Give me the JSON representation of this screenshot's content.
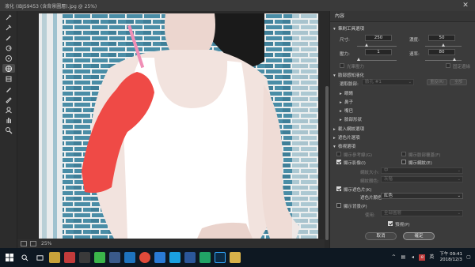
{
  "window": {
    "title": "液化 (IBJS9453 (含背景圖層).jpg @ 25%)"
  },
  "tools": [
    {
      "name": "forward-warp-tool-icon"
    },
    {
      "name": "reconstruct-tool-icon"
    },
    {
      "name": "smooth-tool-icon"
    },
    {
      "name": "twirl-tool-icon"
    },
    {
      "name": "pucker-tool-icon"
    },
    {
      "name": "bloat-tool-icon"
    },
    {
      "name": "push-left-tool-icon"
    },
    {
      "name": "freeze-mask-tool-icon"
    },
    {
      "name": "thaw-mask-tool-icon"
    },
    {
      "name": "face-tool-icon"
    },
    {
      "name": "hand-tool-icon"
    },
    {
      "name": "zoom-tool-icon"
    }
  ],
  "status": {
    "zoom": "25%"
  },
  "panel": {
    "title": "內容",
    "brush_tool_options": {
      "header": "筆刷工具選項",
      "size_label": "尺寸:",
      "size_value": "250",
      "density_label": "濃度:",
      "density_value": "50",
      "pressure_label": "壓力:",
      "pressure_value": "1",
      "rate_label": "速率:",
      "rate_value": "80",
      "stylus_pressure": "光筆壓力",
      "pin_edges": "固定邊緣"
    },
    "face_aware": {
      "header": "臉部感知液化",
      "select_face_label": "選取臉部:",
      "select_face_value": "臉孔 #1",
      "reset_label": "重設(R)",
      "all_label": "全部",
      "eyes": "眼睛",
      "nose": "鼻子",
      "mouth": "嘴巴",
      "face_shape": "臉部形狀"
    },
    "load_mesh": {
      "header": "載入網紋選項"
    },
    "mask_options": {
      "header": "遮色片選項"
    },
    "view_options": {
      "header": "檢視選項",
      "show_guides": "顯示參考線(G)",
      "show_face_overlay": "顯示臉部覆蓋(F)",
      "show_image": "顯示影像(I)",
      "show_mesh": "顯示網紋(E)",
      "mesh_size_label": "網紋大小:",
      "mesh_size_value": "中",
      "mesh_color_label": "網紋顏色:",
      "mesh_color_value": "灰階",
      "show_mask": "顯示遮色片(K)",
      "mask_color_label": "遮色片顏色:",
      "mask_color_value": "紅色",
      "show_backdrop": "顯示背景(P)",
      "use_label": "使用:",
      "use_value": "全部圖層"
    },
    "preview": "預視(P)",
    "cancel": "取消",
    "ok": "確定"
  },
  "taskbar": {
    "start_icon": "windows-start-icon",
    "apps": [
      "search",
      "task-view",
      "file-explorer",
      "store",
      "line",
      "mail",
      "edge",
      "chrome",
      "onedrive",
      "skype",
      "word",
      "excel",
      "photoshop",
      "folder"
    ],
    "tray": {
      "lang": "英",
      "time": "下午 09:41",
      "date": "2018/12/3"
    }
  },
  "colors": {
    "accent": "#3a3a3a",
    "mask": "#ef4a46",
    "brick": "#4a8da6"
  }
}
